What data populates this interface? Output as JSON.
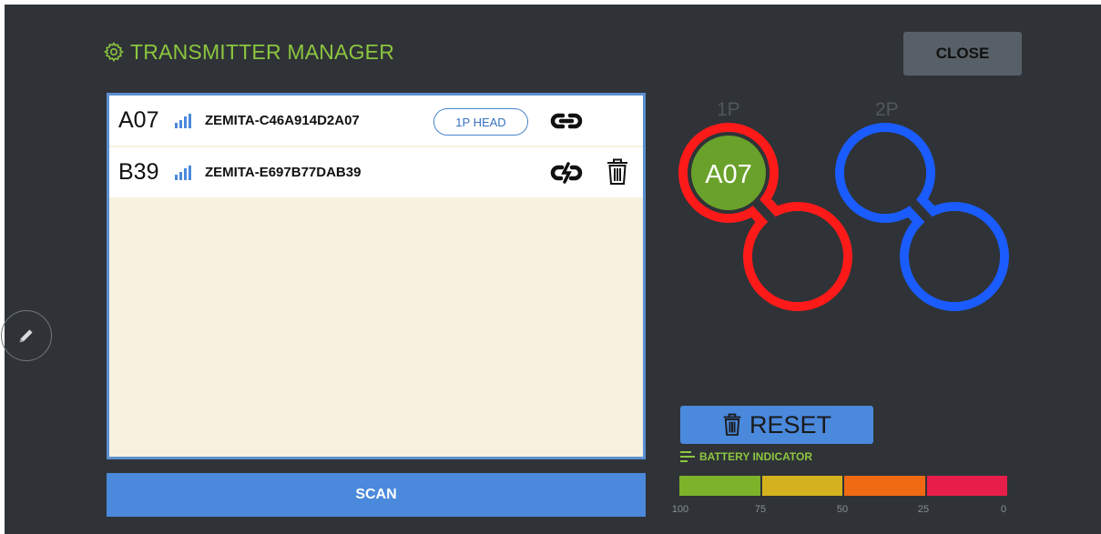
{
  "header": {
    "title": "TRANSMITTER MANAGER",
    "close_label": "CLOSE",
    "accent_color": "#8cc63f"
  },
  "transmitters": [
    {
      "code": "A07",
      "name": "ZEMITA-C46A914D2A07",
      "assignment": "1P HEAD",
      "link_state": "linked",
      "signal_icon": "signal-bars-icon"
    },
    {
      "code": "B39",
      "name": "ZEMITA-E697B77DAB39",
      "assignment": "",
      "link_state": "unlinked",
      "signal_icon": "signal-bars-icon"
    }
  ],
  "scan_label": "SCAN",
  "players": {
    "p1": {
      "label": "1P",
      "color": "#ff1a1a",
      "head_assigned": "A07",
      "assigned_color": "#6aa12a"
    },
    "p2": {
      "label": "2P",
      "color": "#1a5cff"
    }
  },
  "reset_label": "RESET",
  "battery": {
    "label": "BATTERY INDICATOR",
    "segment_colors": [
      "#7cb32b",
      "#d4b21e",
      "#ef6a12",
      "#e81e4a"
    ],
    "ticks": [
      "100",
      "75",
      "50",
      "25",
      "0"
    ]
  }
}
